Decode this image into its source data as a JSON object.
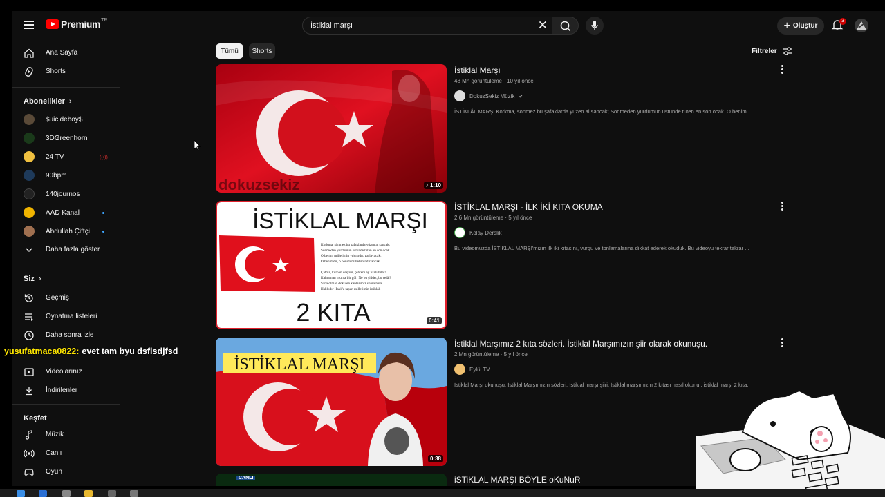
{
  "topbar": {
    "brand": "Premium",
    "region": "TR",
    "search_value": "İstiklal marşı",
    "create_label": "Oluştur",
    "notification_count": "3"
  },
  "sidebar": {
    "main": [
      {
        "label": "Ana Sayfa",
        "icon": "home-icon"
      },
      {
        "label": "Shorts",
        "icon": "shorts-icon"
      }
    ],
    "subscriptions_header": "Abonelikler",
    "subscriptions": [
      {
        "label": "$uicideboy$",
        "color": "#5a4a38"
      },
      {
        "label": "3DGreenhorn",
        "color": "#1a3a1a"
      },
      {
        "label": "24 TV",
        "color": "#f0c040",
        "live": true
      },
      {
        "label": "90bpm",
        "color": "#1e3a5a"
      },
      {
        "label": "140journos",
        "color": "#222222"
      },
      {
        "label": "AAD Kanal",
        "color": "#f0b400",
        "new": true
      },
      {
        "label": "Abdullah Çiftçi",
        "color": "#a07050",
        "new": true
      }
    ],
    "show_more": "Daha fazla göster",
    "you_header": "Siz",
    "you": [
      {
        "label": "Geçmiş",
        "icon": "history-icon"
      },
      {
        "label": "Oynatma listeleri",
        "icon": "playlists-icon"
      },
      {
        "label": "Daha sonra izle",
        "icon": "watch-later-icon"
      },
      {
        "label": "Videolarınız",
        "icon": "your-videos-icon"
      },
      {
        "label": "İndirilenler",
        "icon": "downloads-icon"
      }
    ],
    "explore_header": "Keşfet",
    "explore": [
      {
        "label": "Müzik",
        "icon": "music-icon"
      },
      {
        "label": "Canlı",
        "icon": "live-icon"
      },
      {
        "label": "Oyun",
        "icon": "gaming-icon"
      }
    ]
  },
  "chips": {
    "all": "Tümü",
    "shorts": "Shorts"
  },
  "filters_label": "Filtreler",
  "results": [
    {
      "title": "İstiklal Marşı",
      "views": "48 Mn görüntüleme",
      "age": "10 yıl önce",
      "channel": "DokuzSekiz Müzik",
      "verified": true,
      "description": "İSTİKLÂL MARŞI Korkma, sönmez bu şafaklarda yüzen al sancak; Sönmeden yurdumun üstünde tüten en son ocak. O benim ...",
      "duration": "1:10",
      "thumb_watermark": "dokuzsekiz"
    },
    {
      "title": "İSTİKLAL MARŞI - İLK İKİ KITA OKUMA",
      "views": "2,6 Mn görüntüleme",
      "age": "5 yıl önce",
      "channel": "Kolay Derslik",
      "description": "Bu videomuzda İSTİKLAL MARŞI'mızın ilk iki kıtasını, vurgu ve tonlamalarına dikkat ederek okuduk. Bu videoyu tekrar tekrar ...",
      "duration": "0:41",
      "thumb_heading": "İSTİKLAL MARŞI",
      "thumb_footer": "2 KITA",
      "thumb_poem": [
        "Korkma, sönmez bu şafaklarda yüzen al sancak;",
        "Sönmeden yurdumun üstünde tüten en son ocak.",
        "O benim milletimin yıldızıdır, parlayacak;",
        "O benimdir, o benim milletimindir ancak.",
        "",
        "Çatma, kurban olayım, çehreni ey nazlı hilâl!",
        "Kahraman ırkıma bir gül! Ne bu şiddet, bu celâl?",
        "Sana olmaz dökülen kanlarımız sonra helâl.",
        "Hakkıdır Hakk'a tapan milletimin istiklâl."
      ]
    },
    {
      "title": "İstiklal Marşımız 2 kıta sözleri. İstiklal Marşımızın şiir olarak okunuşu.",
      "views": "2 Mn görüntüleme",
      "age": "5 yıl önce",
      "channel": "Eylül TV",
      "description": "İstiklal Marşı okunuşu. İstiklal Marşımızın sözleri. İstiklal marşı şiiri. İstiklal marşımızın 2 kıtası nasıl okunur. istiklal marşı 2 kıta.",
      "duration": "0:38",
      "thumb_heading": "İSTİKLAL MARŞI"
    },
    {
      "title": "iSTiKLAL MARŞI BÖYLE oKuNuR",
      "thumb_badge": "CANLI"
    }
  ],
  "overlay": {
    "chat_user": "yusufatmaca0822:",
    "chat_message": "evet tam byu dsflsdjfsd"
  },
  "colors": {
    "accent": "#ff0000",
    "background": "#0f0f0f",
    "chip_active": "#f1f1f1"
  }
}
